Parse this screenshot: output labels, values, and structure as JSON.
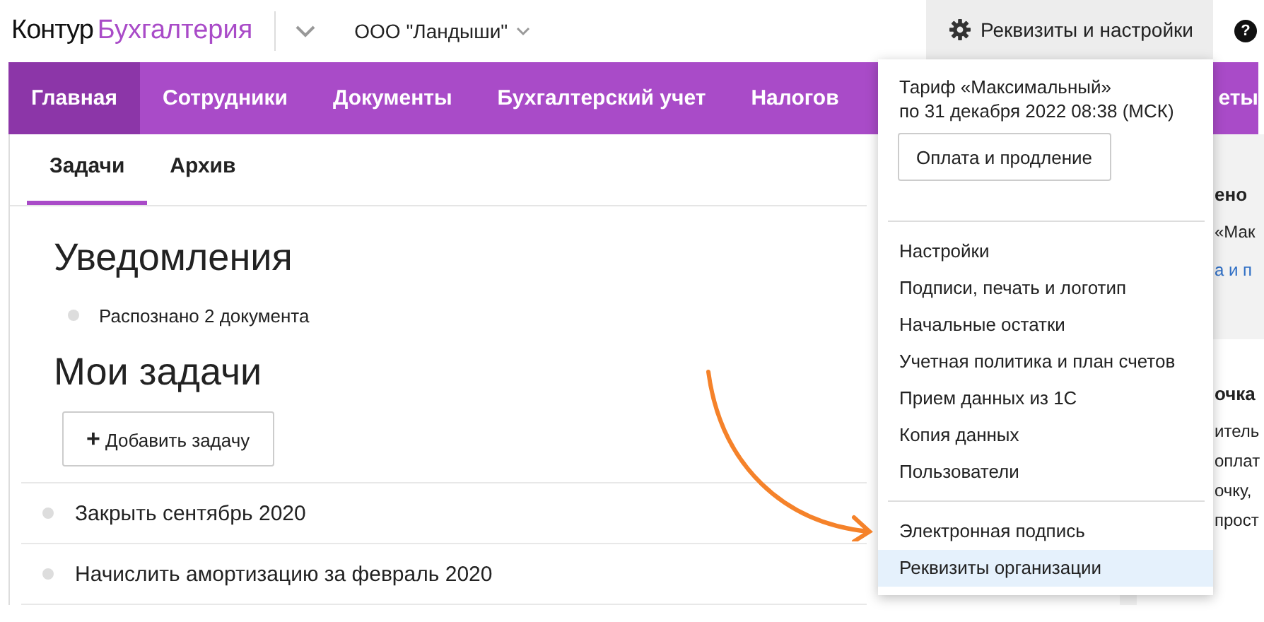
{
  "header": {
    "logo_main": "Контур",
    "logo_product": "Бухгалтерия",
    "organization": "ООО \"Ландыши\"",
    "settings_button": "Реквизиты и настройки",
    "help": "?"
  },
  "nav": [
    {
      "label": "Главная",
      "selected": true
    },
    {
      "label": "Сотрудники",
      "selected": false
    },
    {
      "label": "Документы",
      "selected": false
    },
    {
      "label": "Бухгалтерский учет",
      "selected": false
    },
    {
      "label": "Налогов",
      "selected": false
    },
    {
      "label": "еты",
      "selected": false
    }
  ],
  "subtabs": [
    {
      "label": "Задачи",
      "selected": true
    },
    {
      "label": "Архив",
      "selected": false
    }
  ],
  "notifications": {
    "title": "Уведомления",
    "items": [
      "Распознано 2 документа"
    ]
  },
  "tasks": {
    "title": "Мои задачи",
    "add_icon": "+",
    "add_button": "Добавить задачу",
    "items": [
      "Закрыть сентябрь 2020",
      "Начислить амортизацию за февраль 2020"
    ]
  },
  "side_panel": {
    "cards": [
      {
        "lines": [
          {
            "kind": "heading",
            "text": "ено"
          },
          {
            "kind": "text",
            "text": "«Мак"
          },
          {
            "kind": "link",
            "text": "а и п"
          }
        ]
      },
      {
        "lines": [
          {
            "kind": "heading",
            "text": "очка"
          },
          {
            "kind": "text",
            "text": "итель"
          },
          {
            "kind": "text",
            "text": "оплат"
          },
          {
            "kind": "text",
            "text": "очку,"
          },
          {
            "kind": "text",
            "text": "прост"
          }
        ]
      }
    ]
  },
  "dropdown": {
    "tariff": [
      "Тариф «Максимальный»",
      "по 31 декабря 2022 08:38 (МСК)"
    ],
    "pay_button": "Оплата и продление",
    "groups": [
      [
        {
          "label": "Настройки",
          "selected": false
        },
        {
          "label": "Подписи, печать и логотип",
          "selected": false
        },
        {
          "label": "Начальные остатки",
          "selected": false
        },
        {
          "label": "Учетная политика и план счетов",
          "selected": false
        },
        {
          "label": "Прием данных из 1С",
          "selected": false
        },
        {
          "label": "Копия данных",
          "selected": false
        },
        {
          "label": "Пользователи",
          "selected": false
        }
      ],
      [
        {
          "label": "Электронная подпись",
          "selected": false
        },
        {
          "label": "Реквизиты организации",
          "selected": true
        }
      ]
    ]
  }
}
